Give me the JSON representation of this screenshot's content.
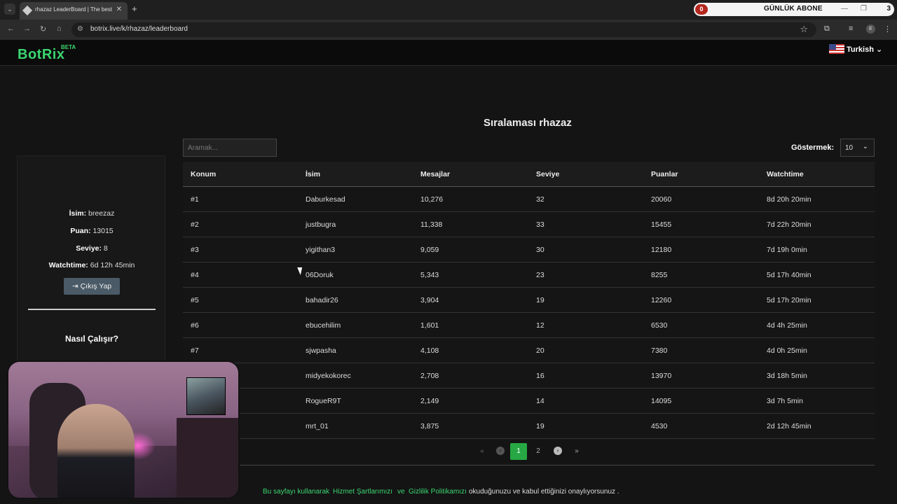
{
  "browser": {
    "tab_title": "rhazaz LeaderBoard | The best (",
    "url": "botrix.live/k/rhazaz/leaderboard",
    "extension": {
      "count": "0",
      "label": "GÜNLÜK ABONE",
      "number": "3"
    },
    "profile_initial": "E"
  },
  "header": {
    "logo": "BotRix",
    "beta": "BETA",
    "language": "Turkish"
  },
  "page": {
    "title": "Sıralaması rhazaz",
    "search_placeholder": "Aramak...",
    "show_label": "Göstermek:",
    "show_value": "10"
  },
  "profile": {
    "name_label": "İsim:",
    "name": "breezaz",
    "points_label": "Puan:",
    "points": "13015",
    "level_label": "Seviye:",
    "level": "8",
    "watchtime_label": "Watchtime:",
    "watchtime": "6d 12h 45min",
    "logout_label": "Çıkış Yap",
    "how_title": "Nasıl Çalışır?"
  },
  "table": {
    "headers": [
      "Konum",
      "İsim",
      "Mesajlar",
      "Seviye",
      "Puanlar",
      "Watchtime"
    ],
    "rows": [
      [
        "#1",
        "Daburkesad",
        "10,276",
        "32",
        "20060",
        "8d 20h 20min"
      ],
      [
        "#2",
        "justbugra",
        "11,338",
        "33",
        "15455",
        "7d 22h 20min"
      ],
      [
        "#3",
        "yigithan3",
        "9,059",
        "30",
        "12180",
        "7d 19h 0min"
      ],
      [
        "#4",
        "06Doruk",
        "5,343",
        "23",
        "8255",
        "5d 17h 40min"
      ],
      [
        "#5",
        "bahadir26",
        "3,904",
        "19",
        "12260",
        "5d 17h 20min"
      ],
      [
        "#6",
        "ebucehilim",
        "1,601",
        "12",
        "6530",
        "4d 4h 25min"
      ],
      [
        "#7",
        "sjwpasha",
        "4,108",
        "20",
        "7380",
        "4d 0h 25min"
      ],
      [
        "",
        "midyekokorec",
        "2,708",
        "16",
        "13970",
        "3d 18h 5min"
      ],
      [
        "",
        "RogueR9T",
        "2,149",
        "14",
        "14095",
        "3d 7h 5min"
      ],
      [
        "",
        "mrt_01",
        "3,875",
        "19",
        "4530",
        "2d 12h 45min"
      ]
    ]
  },
  "pagination": {
    "first": "«",
    "prev": "‹",
    "pages": [
      "1",
      "2"
    ],
    "next": "›",
    "last": "»"
  },
  "footer": {
    "prefix": "Bu sayfayı kullanarak",
    "terms": "Hizmet Şartlarımızı",
    "and": "ve",
    "privacy": "Gizlilik Politikamızı",
    "suffix": "okuduğunuzu ve kabul ettiğinizi onaylıyorsunuz ."
  }
}
